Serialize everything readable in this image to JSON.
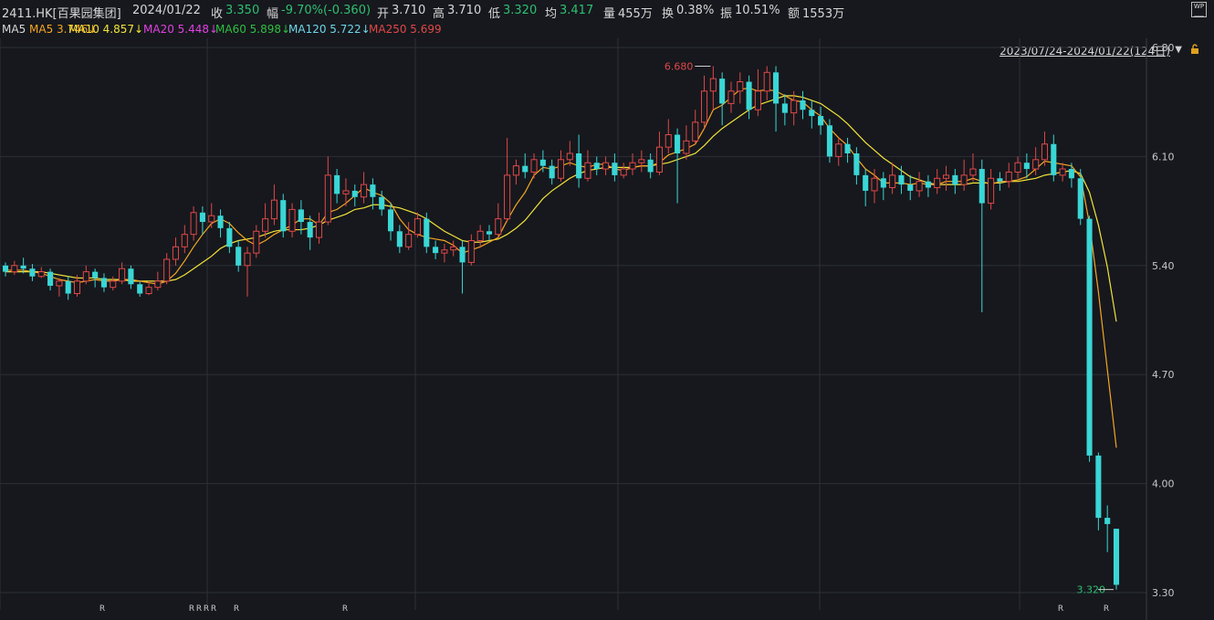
{
  "header": {
    "symbol": "2411.HK[百果园集团]",
    "date": "2024/01/22",
    "close_label": "收",
    "close_value": "3.350",
    "change_label": "幅",
    "change_value": "-9.70%(-0.360)",
    "open_label": "开",
    "open_value": "3.710",
    "high_label": "高",
    "high_value": "3.710",
    "low_label": "低",
    "low_value": "3.320",
    "avg_label": "均",
    "avg_value": "3.417",
    "volume_label": "量",
    "volume_value": "455万",
    "turnover_label": "换",
    "turnover_value": "0.38%",
    "amplitude_label": "振",
    "amplitude_value": "10.51%",
    "amount_label": "额",
    "amount_value": "1553万"
  },
  "ma_bar": {
    "ma5": "MA5 3.746↓",
    "ma10": "MA10 4.857↓",
    "ma20": "MA20 5.448↓",
    "ma60": "MA60 5.898↓",
    "ma120": "MA120 5.722↓",
    "ma250": "MA250 5.699",
    "range": "2023/07/24-2024/01/22(124日)"
  },
  "colors": {
    "background": "#16181d",
    "up": "#e04848",
    "down": "#3ad6d6",
    "ma5": "#f5a623",
    "ma10": "#f2e33a",
    "ma20": "#e040e0",
    "ma60": "#2fbf3f",
    "ma120": "#6fd6e8",
    "grid": "#2c2f36"
  },
  "icons": [
    "lock-icon",
    "wp-icon",
    "caret-down-icon"
  ],
  "chart_data": {
    "type": "candlestick",
    "ylim": [
      3.3,
      6.8
    ],
    "yticks": [
      "6.80",
      "6.10",
      "5.40",
      "4.70",
      "4.00",
      "3.30"
    ],
    "annotations": {
      "high": "6.680",
      "low": "3.320"
    },
    "r_marks": "R",
    "candles": [
      [
        5.4,
        5.36,
        5.42,
        5.33
      ],
      [
        5.36,
        5.4,
        5.43,
        5.34
      ],
      [
        5.4,
        5.38,
        5.45,
        5.35
      ],
      [
        5.38,
        5.33,
        5.41,
        5.3
      ],
      [
        5.33,
        5.36,
        5.39,
        5.32
      ],
      [
        5.36,
        5.27,
        5.38,
        5.24
      ],
      [
        5.27,
        5.3,
        5.32,
        5.2
      ],
      [
        5.3,
        5.22,
        5.33,
        5.18
      ],
      [
        5.22,
        5.3,
        5.34,
        5.2
      ],
      [
        5.3,
        5.36,
        5.4,
        5.28
      ],
      [
        5.36,
        5.32,
        5.38,
        5.26
      ],
      [
        5.32,
        5.26,
        5.35,
        5.23
      ],
      [
        5.26,
        5.3,
        5.33,
        5.24
      ],
      [
        5.3,
        5.38,
        5.42,
        5.28
      ],
      [
        5.38,
        5.28,
        5.4,
        5.25
      ],
      [
        5.28,
        5.22,
        5.3,
        5.2
      ],
      [
        5.22,
        5.26,
        5.3,
        5.21
      ],
      [
        5.26,
        5.3,
        5.36,
        5.24
      ],
      [
        5.3,
        5.44,
        5.48,
        5.28
      ],
      [
        5.44,
        5.52,
        5.58,
        5.4
      ],
      [
        5.52,
        5.6,
        5.66,
        5.48
      ],
      [
        5.6,
        5.74,
        5.78,
        5.56
      ],
      [
        5.74,
        5.68,
        5.78,
        5.6
      ],
      [
        5.68,
        5.72,
        5.8,
        5.64
      ],
      [
        5.72,
        5.64,
        5.76,
        5.58
      ],
      [
        5.64,
        5.52,
        5.68,
        5.48
      ],
      [
        5.52,
        5.4,
        5.56,
        5.36
      ],
      [
        5.4,
        5.48,
        5.52,
        5.2
      ],
      [
        5.48,
        5.62,
        5.66,
        5.45
      ],
      [
        5.62,
        5.7,
        5.8,
        5.58
      ],
      [
        5.7,
        5.82,
        5.92,
        5.66
      ],
      [
        5.82,
        5.62,
        5.86,
        5.58
      ],
      [
        5.62,
        5.76,
        5.8,
        5.58
      ],
      [
        5.76,
        5.68,
        5.82,
        5.6
      ],
      [
        5.68,
        5.58,
        5.72,
        5.5
      ],
      [
        5.58,
        5.68,
        5.74,
        5.54
      ],
      [
        5.68,
        5.98,
        6.1,
        5.66
      ],
      [
        5.98,
        5.86,
        6.02,
        5.8
      ],
      [
        5.86,
        5.88,
        5.96,
        5.78
      ],
      [
        5.88,
        5.84,
        5.92,
        5.78
      ],
      [
        5.84,
        5.92,
        6.0,
        5.8
      ],
      [
        5.92,
        5.84,
        5.96,
        5.76
      ],
      [
        5.84,
        5.76,
        5.88,
        5.72
      ],
      [
        5.76,
        5.62,
        5.8,
        5.56
      ],
      [
        5.62,
        5.52,
        5.66,
        5.48
      ],
      [
        5.52,
        5.6,
        5.68,
        5.5
      ],
      [
        5.6,
        5.7,
        5.74,
        5.58
      ],
      [
        5.7,
        5.52,
        5.74,
        5.48
      ],
      [
        5.52,
        5.48,
        5.56,
        5.44
      ],
      [
        5.48,
        5.5,
        5.54,
        5.42
      ],
      [
        5.5,
        5.52,
        5.56,
        5.46
      ],
      [
        5.52,
        5.42,
        5.56,
        5.22
      ],
      [
        5.42,
        5.56,
        5.6,
        5.4
      ],
      [
        5.56,
        5.62,
        5.66,
        5.52
      ],
      [
        5.62,
        5.6,
        5.66,
        5.56
      ],
      [
        5.6,
        5.7,
        5.8,
        5.58
      ],
      [
        5.7,
        5.98,
        6.22,
        5.68
      ],
      [
        5.98,
        6.04,
        6.08,
        5.92
      ],
      [
        6.04,
        6.0,
        6.12,
        5.96
      ],
      [
        6.0,
        6.08,
        6.12,
        5.96
      ],
      [
        6.08,
        6.04,
        6.14,
        6.0
      ],
      [
        6.04,
        5.96,
        6.08,
        5.92
      ],
      [
        5.96,
        6.08,
        6.14,
        5.94
      ],
      [
        6.08,
        6.12,
        6.2,
        6.04
      ],
      [
        6.12,
        5.96,
        6.24,
        5.9
      ],
      [
        5.96,
        6.06,
        6.14,
        5.94
      ],
      [
        6.06,
        6.02,
        6.1,
        5.98
      ],
      [
        6.02,
        6.06,
        6.1,
        5.98
      ],
      [
        6.06,
        5.98,
        6.12,
        5.94
      ],
      [
        5.98,
        6.02,
        6.06,
        5.96
      ],
      [
        6.02,
        6.06,
        6.12,
        5.98
      ],
      [
        6.06,
        6.08,
        6.14,
        6.0
      ],
      [
        6.08,
        6.0,
        6.12,
        5.96
      ],
      [
        6.0,
        6.16,
        6.26,
        5.98
      ],
      [
        6.16,
        6.24,
        6.34,
        6.12
      ],
      [
        6.24,
        6.12,
        6.28,
        5.8
      ],
      [
        6.12,
        6.2,
        6.3,
        6.08
      ],
      [
        6.2,
        6.32,
        6.4,
        6.18
      ],
      [
        6.32,
        6.52,
        6.62,
        6.28
      ],
      [
        6.52,
        6.6,
        6.68,
        6.4
      ],
      [
        6.6,
        6.44,
        6.64,
        6.3
      ],
      [
        6.44,
        6.52,
        6.58,
        6.38
      ],
      [
        6.52,
        6.58,
        6.64,
        6.44
      ],
      [
        6.58,
        6.4,
        6.62,
        6.34
      ],
      [
        6.4,
        6.52,
        6.66,
        6.36
      ],
      [
        6.52,
        6.64,
        6.68,
        6.46
      ],
      [
        6.64,
        6.44,
        6.68,
        6.26
      ],
      [
        6.44,
        6.38,
        6.5,
        6.3
      ],
      [
        6.38,
        6.46,
        6.52,
        6.3
      ],
      [
        6.46,
        6.4,
        6.52,
        6.34
      ],
      [
        6.4,
        6.36,
        6.46,
        6.28
      ],
      [
        6.36,
        6.3,
        6.42,
        6.24
      ],
      [
        6.3,
        6.1,
        6.34,
        6.06
      ],
      [
        6.1,
        6.18,
        6.22,
        6.04
      ],
      [
        6.18,
        6.12,
        6.22,
        6.06
      ],
      [
        6.12,
        5.98,
        6.16,
        5.92
      ],
      [
        5.98,
        5.88,
        6.02,
        5.78
      ],
      [
        5.88,
        5.96,
        6.02,
        5.8
      ],
      [
        5.96,
        5.9,
        6.0,
        5.82
      ],
      [
        5.9,
        5.98,
        6.06,
        5.86
      ],
      [
        5.98,
        5.92,
        6.04,
        5.86
      ],
      [
        5.92,
        5.88,
        5.98,
        5.82
      ],
      [
        5.88,
        5.94,
        6.0,
        5.84
      ],
      [
        5.94,
        5.9,
        5.98,
        5.84
      ],
      [
        5.9,
        5.96,
        6.02,
        5.86
      ],
      [
        5.96,
        5.98,
        6.04,
        5.88
      ],
      [
        5.98,
        5.92,
        6.02,
        5.86
      ],
      [
        5.92,
        5.98,
        6.08,
        5.88
      ],
      [
        5.98,
        6.02,
        6.12,
        5.94
      ],
      [
        6.02,
        5.8,
        6.08,
        5.1
      ],
      [
        5.8,
        5.96,
        6.02,
        5.76
      ],
      [
        5.96,
        5.94,
        6.0,
        5.88
      ],
      [
        5.94,
        6.0,
        6.06,
        5.9
      ],
      [
        6.0,
        6.06,
        6.1,
        5.96
      ],
      [
        6.06,
        6.02,
        6.12,
        5.96
      ],
      [
        6.02,
        6.08,
        6.16,
        5.98
      ],
      [
        6.08,
        6.18,
        6.26,
        6.04
      ],
      [
        6.18,
        5.98,
        6.24,
        5.94
      ],
      [
        5.98,
        6.02,
        6.06,
        5.94
      ],
      [
        6.02,
        5.96,
        6.06,
        5.9
      ],
      [
        5.96,
        5.7,
        6.02,
        5.66
      ],
      [
        5.7,
        4.18,
        5.72,
        4.14
      ],
      [
        4.18,
        3.78,
        4.2,
        3.7
      ],
      [
        3.78,
        3.74,
        3.86,
        3.56
      ],
      [
        3.71,
        3.35,
        3.71,
        3.32
      ]
    ],
    "ma": {
      "ma5": [
        5.37,
        5.37,
        5.37,
        5.36,
        5.35,
        5.33,
        5.31,
        5.3,
        5.29,
        5.3,
        5.31,
        5.3,
        5.3,
        5.31,
        5.31,
        5.3,
        5.29,
        5.28,
        5.3,
        5.35,
        5.43,
        5.52,
        5.6,
        5.67,
        5.7,
        5.67,
        5.61,
        5.56,
        5.53,
        5.56,
        5.6,
        5.63,
        5.66,
        5.7,
        5.7,
        5.66,
        5.74,
        5.76,
        5.8,
        5.85,
        5.9,
        5.87,
        5.85,
        5.8,
        5.7,
        5.63,
        5.6,
        5.58,
        5.57,
        5.56,
        5.53,
        5.48,
        5.5,
        5.52,
        5.55,
        5.58,
        5.69,
        5.79,
        5.87,
        5.98,
        6.03,
        6.02,
        6.04,
        6.06,
        6.04,
        6.03,
        6.05,
        6.05,
        6.02,
        6.01,
        6.03,
        6.04,
        6.04,
        6.06,
        6.11,
        6.13,
        6.15,
        6.18,
        6.28,
        6.4,
        6.43,
        6.48,
        6.53,
        6.54,
        6.52,
        6.53,
        6.52,
        6.49,
        6.46,
        6.45,
        6.4,
        6.36,
        6.28,
        6.22,
        6.17,
        6.09,
        6.02,
        5.98,
        5.93,
        5.93,
        5.93,
        5.92,
        5.93,
        5.92,
        5.92,
        5.94,
        5.94,
        5.94,
        5.96,
        5.94,
        5.92,
        5.94,
        5.94,
        5.95,
        5.97,
        6.02,
        6.07,
        6.06,
        6.05,
        6.04,
        5.97,
        5.67,
        5.23,
        4.73,
        4.23
      ],
      "ma10": [
        5.36,
        5.36,
        5.36,
        5.36,
        5.36,
        5.35,
        5.34,
        5.33,
        5.32,
        5.32,
        5.32,
        5.31,
        5.31,
        5.31,
        5.3,
        5.3,
        5.3,
        5.3,
        5.3,
        5.31,
        5.34,
        5.38,
        5.42,
        5.46,
        5.51,
        5.54,
        5.56,
        5.57,
        5.58,
        5.6,
        5.62,
        5.63,
        5.63,
        5.63,
        5.64,
        5.66,
        5.69,
        5.71,
        5.73,
        5.76,
        5.77,
        5.79,
        5.79,
        5.78,
        5.77,
        5.75,
        5.73,
        5.7,
        5.66,
        5.62,
        5.59,
        5.56,
        5.55,
        5.55,
        5.56,
        5.57,
        5.6,
        5.64,
        5.69,
        5.76,
        5.83,
        5.88,
        5.92,
        5.96,
        5.99,
        6.01,
        6.02,
        6.03,
        6.03,
        6.03,
        6.03,
        6.04,
        6.04,
        6.05,
        6.06,
        6.08,
        6.1,
        6.12,
        6.17,
        6.23,
        6.28,
        6.32,
        6.36,
        6.4,
        6.43,
        6.45,
        6.47,
        6.49,
        6.49,
        6.48,
        6.46,
        6.44,
        6.4,
        6.36,
        6.31,
        6.25,
        6.19,
        6.14,
        6.09,
        6.05,
        6.01,
        5.97,
        5.95,
        5.93,
        5.92,
        5.92,
        5.92,
        5.92,
        5.93,
        5.93,
        5.93,
        5.93,
        5.94,
        5.94,
        5.95,
        5.96,
        5.98,
        5.99,
        6.0,
        6.01,
        5.99,
        5.87,
        5.66,
        5.39,
        5.04
      ]
    }
  }
}
